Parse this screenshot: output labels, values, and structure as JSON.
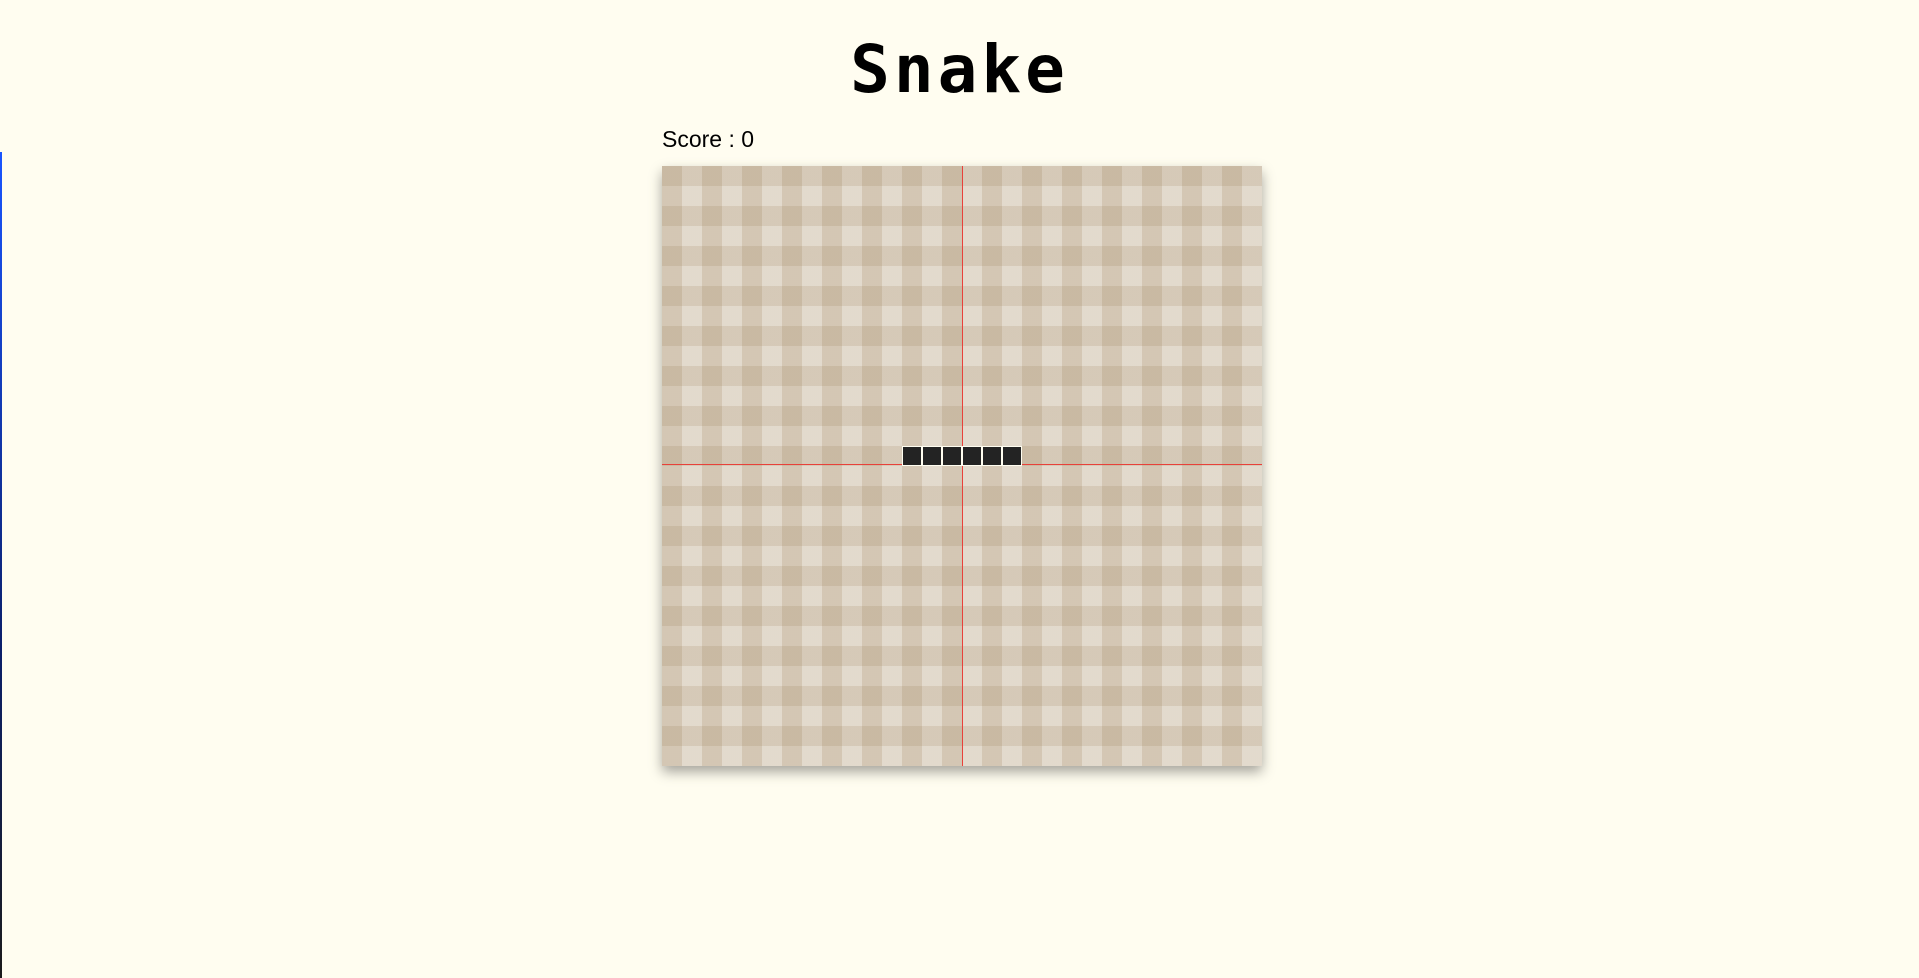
{
  "title": "Snake",
  "score": {
    "label": "Score :",
    "value": "0"
  },
  "board": {
    "grid_cols": 30,
    "grid_rows": 30,
    "snake_cells": [
      {
        "col": 12,
        "row": 14
      },
      {
        "col": 13,
        "row": 14
      },
      {
        "col": 14,
        "row": 14
      },
      {
        "col": 15,
        "row": 14
      },
      {
        "col": 16,
        "row": 14
      },
      {
        "col": 17,
        "row": 14
      }
    ],
    "colors": {
      "snake": "#232323",
      "guide_lines": "#e8413a",
      "board": "#dcd1c1",
      "page_background": "#fffdf0"
    }
  }
}
